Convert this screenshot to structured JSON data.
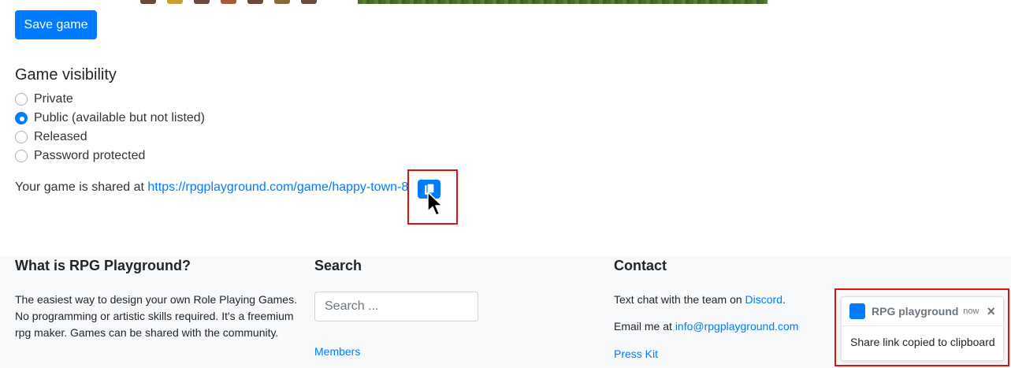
{
  "actions": {
    "save_label": "Save game"
  },
  "visibility": {
    "title": "Game visibility",
    "options": [
      {
        "label": "Private",
        "checked": false
      },
      {
        "label": "Public (available but not listed)",
        "checked": true
      },
      {
        "label": "Released",
        "checked": false
      },
      {
        "label": "Password protected",
        "checked": false
      }
    ]
  },
  "share": {
    "prefix": "Your game is shared at",
    "url": "https://rpgplayground.com/game/happy-town-8"
  },
  "footer": {
    "about": {
      "title": "What is RPG Playground?",
      "text": "The easiest way to design your own Role Playing Games. No programming or artistic skills required. It's a freemium rpg maker. Games can be shared with the community."
    },
    "search": {
      "title": "Search",
      "placeholder": "Search ...",
      "members_link": "Members"
    },
    "contact": {
      "title": "Contact",
      "chat_prefix": "Text chat with the team on",
      "chat_link": "Discord",
      "chat_suffix": ".",
      "email_prefix": "Email me at",
      "email_link": "info@rpgplayground.com",
      "press_kit": "Press Kit"
    }
  },
  "toast": {
    "title": "RPG playground",
    "time": "now",
    "close": "×",
    "message": "Share link copied to clipboard"
  },
  "colors": {
    "accent": "#007bff",
    "highlight": "#e01010",
    "footer_bg": "#f8f9fa"
  }
}
